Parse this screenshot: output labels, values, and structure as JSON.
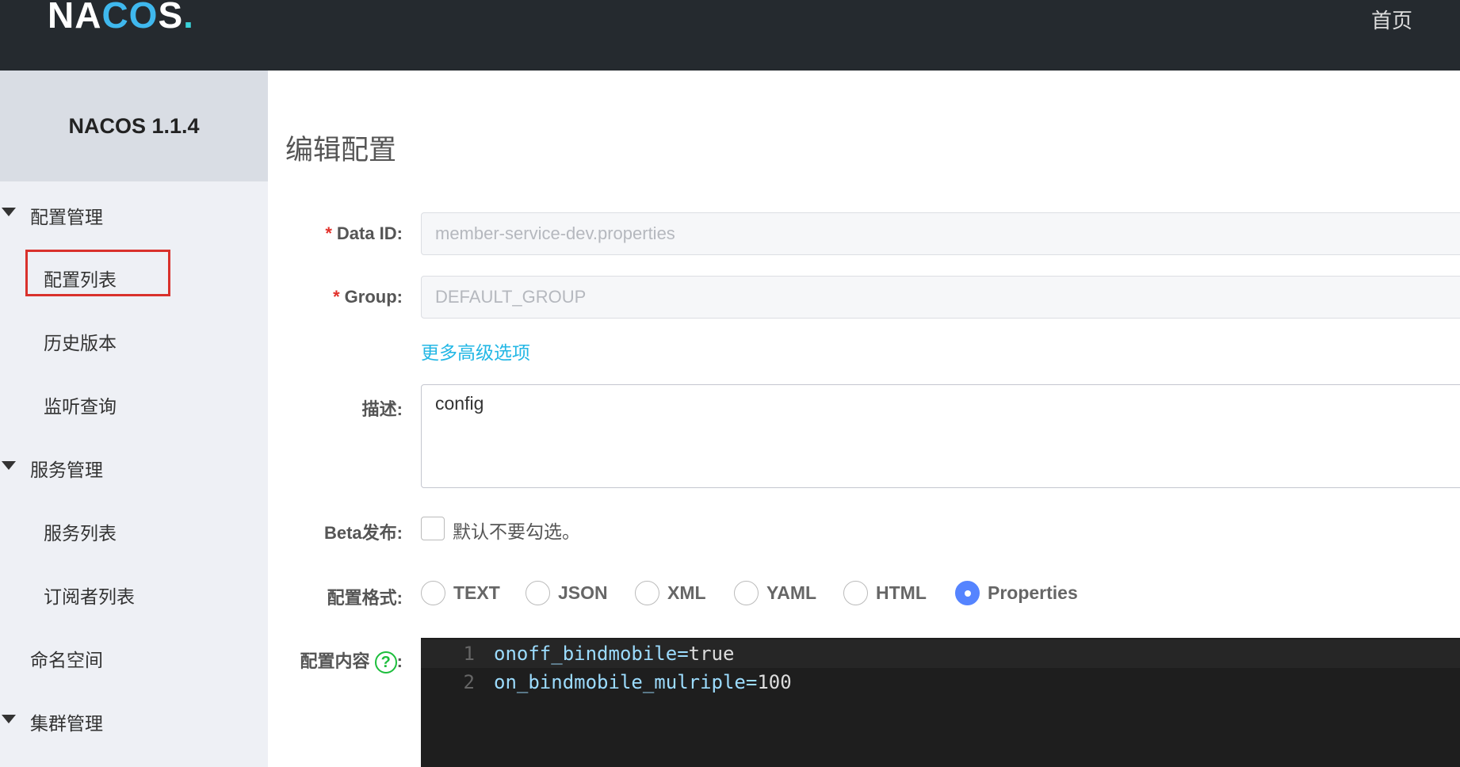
{
  "header": {
    "logo": "NACOS.",
    "home": "首页"
  },
  "sidebar": {
    "version": "NACOS 1.1.4",
    "groups": [
      {
        "label": "配置管理",
        "items": [
          "配置列表",
          "历史版本",
          "监听查询"
        ]
      },
      {
        "label": "服务管理",
        "items": [
          "服务列表",
          "订阅者列表"
        ]
      },
      {
        "label": "命名空间"
      },
      {
        "label": "集群管理"
      }
    ]
  },
  "form": {
    "title": "编辑配置",
    "data_id": {
      "label": "Data ID:",
      "value": "member-service-dev.properties"
    },
    "group": {
      "label": "Group:",
      "value": "DEFAULT_GROUP"
    },
    "advanced_link": "更多高级选项",
    "desc": {
      "label": "描述:",
      "value": "config"
    },
    "beta": {
      "label": "Beta发布:",
      "hint": "默认不要勾选。",
      "checked": false
    },
    "format": {
      "label": "配置格式:",
      "options": [
        "TEXT",
        "JSON",
        "XML",
        "YAML",
        "HTML",
        "Properties"
      ],
      "selected": "Properties"
    },
    "content": {
      "label": "配置内容",
      "help": "?",
      "colon": ":",
      "lines": [
        {
          "n": "1",
          "key": "onoff_bindmobile=",
          "val": "true"
        },
        {
          "n": "2",
          "key": "on_bindmobile_mulriple=",
          "val": "100"
        }
      ]
    }
  },
  "colors": {
    "header": "#252a2f",
    "link": "#23b7e5",
    "radio_selected": "#5584ff",
    "highlight_box": "#d9312c"
  }
}
